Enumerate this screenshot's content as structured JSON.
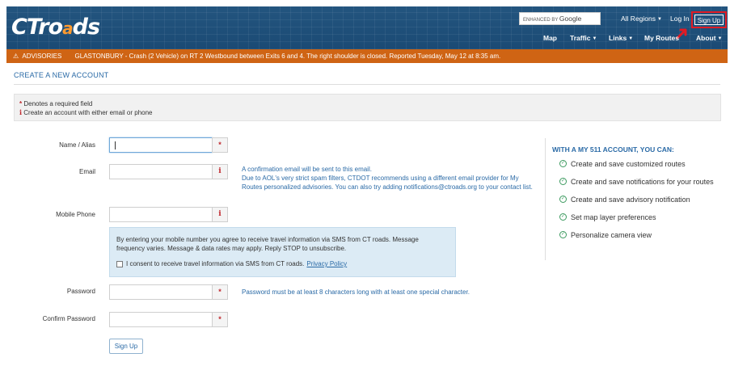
{
  "header": {
    "logo_text_1": "CT",
    "logo_text_2": "ro",
    "logo_text_3": "a",
    "logo_text_4": "ds",
    "search_prefix": "ENHANCED BY",
    "search_brand": "Google",
    "regions_label": "All Regions",
    "login_label": "Log In",
    "signup_label": "Sign Up",
    "nav": {
      "map": "Map",
      "traffic": "Traffic",
      "links": "Links",
      "my_routes": "My Routes",
      "about": "About"
    }
  },
  "advisory": {
    "label": "ADVISORIES",
    "message": "GLASTONBURY - Crash (2 Vehicle) on RT 2 Westbound between Exits 6 and 4. The right shoulder is closed. Reported Tuesday, May 12 at 8:35 am."
  },
  "page": {
    "title": "CREATE A NEW ACCOUNT",
    "notice_required": "Denotes a required field",
    "notice_either": "Create an account with either email or phone"
  },
  "form": {
    "name_label": "Name / Alias",
    "email_label": "Email",
    "email_help": "A confirmation email will be sent to this email.",
    "email_help_2": "Due to AOL's very strict spam filters, CTDOT recommends using a different email provider for My Routes personalized advisories. You can also try adding notifications@ctroads.org to your contact list.",
    "phone_label": "Mobile Phone",
    "sms_text": "By entering your mobile number you agree to receive travel information via SMS from CT roads. Message frequency varies. Message & data rates may apply. Reply STOP to unsubscribe.",
    "sms_consent": "I consent to receive travel information via SMS from CT roads.",
    "privacy_link": "Privacy Policy",
    "password_label": "Password",
    "password_help": "Password must be at least 8 characters long with at least one special character.",
    "confirm_label": "Confirm Password",
    "submit_label": "Sign Up",
    "required_symbol": "*",
    "info_symbol": "i"
  },
  "benefits": {
    "title": "WITH A MY 511 ACCOUNT, YOU CAN:",
    "items": [
      "Create and save customized routes",
      "Create and save notifications for your routes",
      "Create and save advisory notification",
      "Set map layer preferences",
      "Personalize camera view"
    ]
  },
  "colors": {
    "header_bg": "#1f4f7c",
    "advisory_bg": "#cf6414",
    "accent": "#2a6aa6",
    "required": "#c0272d",
    "highlight": "#e01b24"
  }
}
